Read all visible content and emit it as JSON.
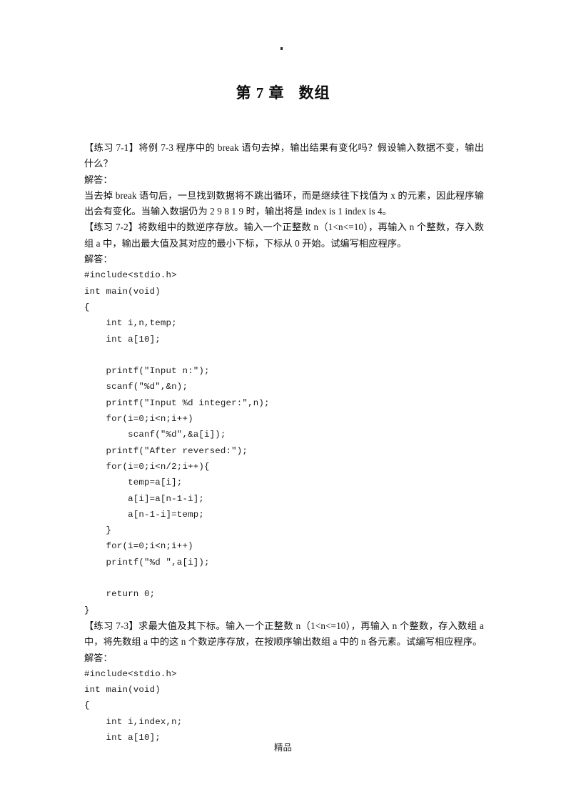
{
  "document": {
    "top_mark": "·",
    "chapter_title_prefix": "第 7 章",
    "chapter_title_name": "数组",
    "footer": "精品"
  },
  "exercises": [
    {
      "prompt": "【练习 7-1】将例 7-3 程序中的 break 语句去掉，输出结果有变化吗？假设输入数据不变，输出什么？",
      "answer_label": "解答：",
      "answer_text": "当去掉 break 语句后，一旦找到数据将不跳出循环，而是继续往下找值为 x 的元素，因此程序输出会有变化。当输入数据仍为 2 9 8 1 9 时，输出将是 index is 1 index is 4。"
    },
    {
      "prompt": "【练习 7-2】将数组中的数逆序存放。输入一个正整数 n（1<n<=10），再输入 n 个整数，存入数组 a 中，输出最大值及其对应的最小下标，下标从 0 开始。试编写相应程序。",
      "answer_label": "解答：",
      "code": "#include<stdio.h>\nint main(void)\n{\n    int i,n,temp;\n    int a[10];\n\n    printf(\"Input n:\");\n    scanf(\"%d\",&n);\n    printf(\"Input %d integer:\",n);\n    for(i=0;i<n;i++)\n        scanf(\"%d\",&a[i]);\n    printf(\"After reversed:\");\n    for(i=0;i<n/2;i++){\n        temp=a[i];\n        a[i]=a[n-1-i];\n        a[n-1-i]=temp;\n    }\n    for(i=0;i<n;i++)\n    printf(\"%d \",a[i]);\n\n    return 0;\n}"
    },
    {
      "prompt": "【练习 7-3】求最大值及其下标。输入一个正整数 n（1<n<=10），再输入 n 个整数，存入数组 a 中，将先数组 a 中的这 n 个数逆序存放，在按顺序输出数组 a 中的 n 各元素。试编写相应程序。",
      "answer_label": "解答：",
      "code": "#include<stdio.h>\nint main(void)\n{\n    int i,index,n;\n    int a[10];"
    }
  ]
}
